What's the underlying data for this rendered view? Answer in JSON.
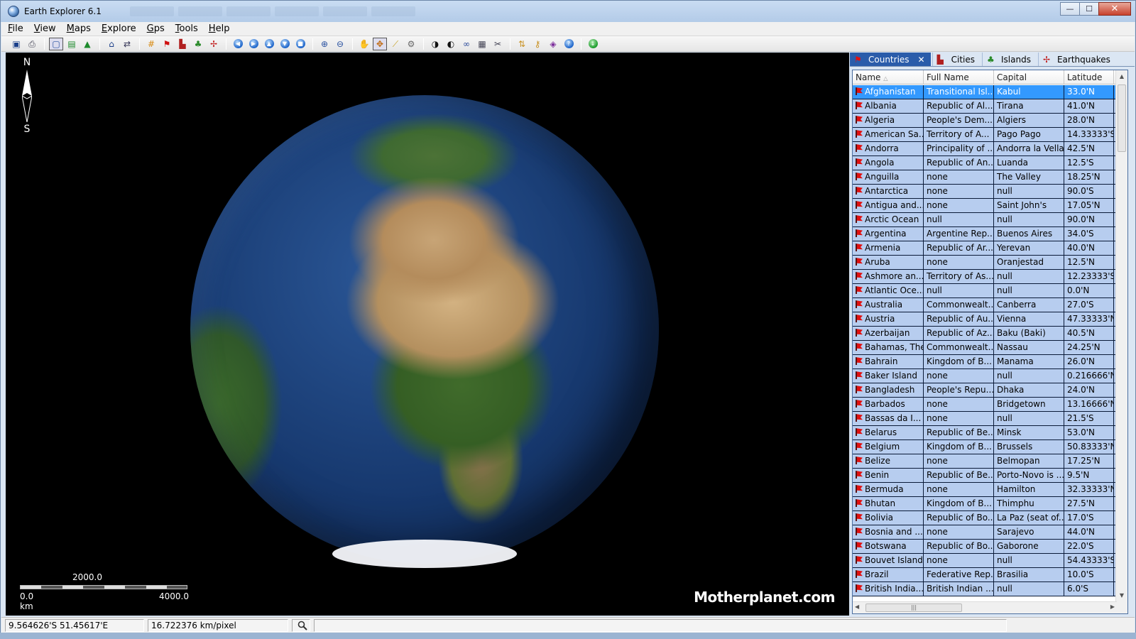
{
  "window": {
    "title": "Earth Explorer 6.1",
    "minimize_glyph": "—",
    "maximize_glyph": "☐",
    "close_glyph": "✕"
  },
  "menu": [
    {
      "id": "file",
      "accel": "F",
      "rest": "ile"
    },
    {
      "id": "view",
      "accel": "V",
      "rest": "iew"
    },
    {
      "id": "maps",
      "accel": "M",
      "rest": "aps"
    },
    {
      "id": "explore",
      "accel": "E",
      "rest": "xplore"
    },
    {
      "id": "gps",
      "accel": "G",
      "rest": "ps"
    },
    {
      "id": "tools",
      "accel": "T",
      "rest": "ools"
    },
    {
      "id": "help",
      "accel": "H",
      "rest": "elp"
    }
  ],
  "globe_view": {
    "compass_north": "N",
    "compass_south": "S",
    "scale_mid": "2000.0",
    "scale_left": "0.0 km",
    "scale_right": "4000.0",
    "watermark": "Motherplanet.com"
  },
  "tabs": [
    {
      "id": "countries",
      "label": "Countries",
      "active": true
    },
    {
      "id": "cities",
      "label": "Cities",
      "active": false
    },
    {
      "id": "islands",
      "label": "Islands",
      "active": false
    },
    {
      "id": "earthquakes",
      "label": "Earthquakes",
      "active": false
    }
  ],
  "table": {
    "headers": [
      "Name",
      "Full Name",
      "Capital",
      "Latitude"
    ],
    "sort_indicator": "△",
    "rows": [
      [
        "Afghanistan",
        "Transitional Isl...",
        "Kabul",
        "33.0'N"
      ],
      [
        "Albania",
        "Republic of Al...",
        "Tirana",
        "41.0'N"
      ],
      [
        "Algeria",
        "People's Dem...",
        "Algiers",
        "28.0'N"
      ],
      [
        "American Sa...",
        "Territory of A...",
        "Pago Pago",
        "14.33333'S"
      ],
      [
        "Andorra",
        "Principality of ...",
        "Andorra la Vella",
        "42.5'N"
      ],
      [
        "Angola",
        "Republic of An...",
        "Luanda",
        "12.5'S"
      ],
      [
        "Anguilla",
        "none",
        "The Valley",
        "18.25'N"
      ],
      [
        "Antarctica",
        "none",
        "null",
        "90.0'S"
      ],
      [
        "Antigua and...",
        "none",
        "Saint John's",
        "17.05'N"
      ],
      [
        "Arctic Ocean",
        "null",
        "null",
        "90.0'N"
      ],
      [
        "Argentina",
        "Argentine Rep...",
        "Buenos Aires",
        "34.0'S"
      ],
      [
        "Armenia",
        "Republic of Ar...",
        "Yerevan",
        "40.0'N"
      ],
      [
        "Aruba",
        "none",
        "Oranjestad",
        "12.5'N"
      ],
      [
        "Ashmore an...",
        "Territory of As...",
        "null",
        "12.23333'S"
      ],
      [
        "Atlantic Oce...",
        "null",
        "null",
        "0.0'N"
      ],
      [
        "Australia",
        "Commonwealt...",
        "Canberra",
        "27.0'S"
      ],
      [
        "Austria",
        "Republic of Au...",
        "Vienna",
        "47.33333'N"
      ],
      [
        "Azerbaijan",
        "Republic of Az...",
        "Baku (Baki)",
        "40.5'N"
      ],
      [
        "Bahamas, The",
        "Commonwealt...",
        "Nassau",
        "24.25'N"
      ],
      [
        "Bahrain",
        "Kingdom of B...",
        "Manama",
        "26.0'N"
      ],
      [
        "Baker Island",
        "none",
        "null",
        "0.216666'N"
      ],
      [
        "Bangladesh",
        "People's Repu...",
        "Dhaka",
        "24.0'N"
      ],
      [
        "Barbados",
        "none",
        "Bridgetown",
        "13.16666'N"
      ],
      [
        "Bassas da I...",
        "none",
        "null",
        "21.5'S"
      ],
      [
        "Belarus",
        "Republic of Be...",
        "Minsk",
        "53.0'N"
      ],
      [
        "Belgium",
        "Kingdom of B...",
        "Brussels",
        "50.83333'N"
      ],
      [
        "Belize",
        "none",
        "Belmopan",
        "17.25'N"
      ],
      [
        "Benin",
        "Republic of Be...",
        "Porto-Novo is ...",
        "9.5'N"
      ],
      [
        "Bermuda",
        "none",
        "Hamilton",
        "32.33333'N"
      ],
      [
        "Bhutan",
        "Kingdom of B...",
        "Thimphu",
        "27.5'N"
      ],
      [
        "Bolivia",
        "Republic of Bo...",
        "La Paz (seat of...",
        "17.0'S"
      ],
      [
        "Bosnia and ...",
        "none",
        "Sarajevo",
        "44.0'N"
      ],
      [
        "Botswana",
        "Republic of Bo...",
        "Gaborone",
        "22.0'S"
      ],
      [
        "Bouvet Island",
        "none",
        "null",
        "54.43333'S"
      ],
      [
        "Brazil",
        "Federative Rep...",
        "Brasilia",
        "10.0'S"
      ],
      [
        "British India...",
        "British Indian ...",
        "null",
        "6.0'S"
      ]
    ]
  },
  "status": {
    "coords": "9.564626'S  51.45617'E",
    "scale": "16.722376 km/pixel"
  },
  "colors": {
    "selected_row": "#3399ff",
    "row_bg": "#b7cdef",
    "active_tab": "#2a5caa"
  }
}
